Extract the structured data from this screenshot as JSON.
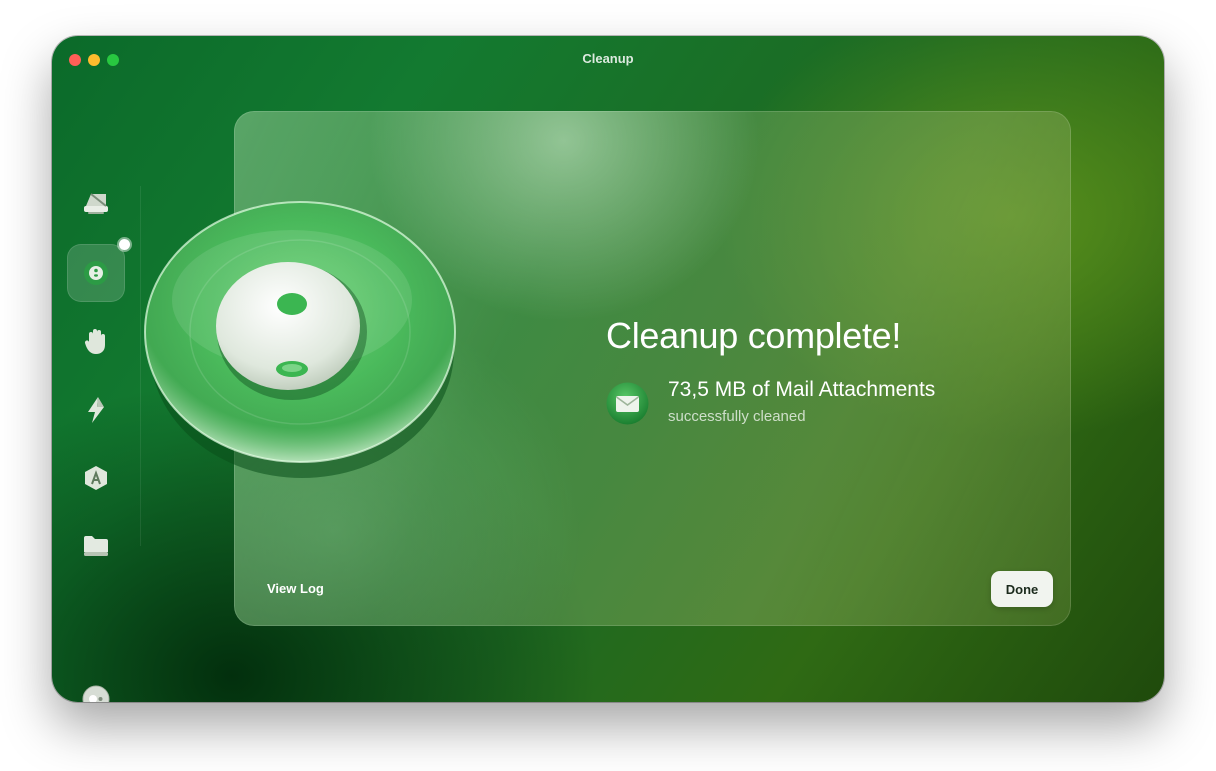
{
  "window": {
    "title": "Cleanup"
  },
  "sidebar": {
    "items": [
      {
        "icon": "disk-cleanup-icon"
      },
      {
        "icon": "mail-cleanup-icon",
        "active": true
      },
      {
        "icon": "privacy-hand-icon"
      },
      {
        "icon": "speed-lightning-icon"
      },
      {
        "icon": "applications-icon"
      },
      {
        "icon": "files-folder-icon"
      }
    ],
    "account_icon": "account-toggle-icon"
  },
  "result": {
    "headline": "Cleanup complete!",
    "amount": "73,5 MB of Mail Attachments",
    "status": "successfully cleaned",
    "icon": "mail-envelope-icon"
  },
  "footer": {
    "view_log_label": "View Log",
    "done_label": "Done"
  },
  "colors": {
    "accent": "#3fae52",
    "window_bg": "#137a30",
    "done_button_bg": "#f1f4ef"
  }
}
